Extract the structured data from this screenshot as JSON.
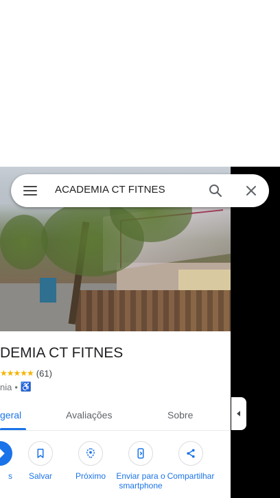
{
  "search": {
    "query": "ACADEMIA CT FITNES"
  },
  "place": {
    "title": "DEMIA CT FITNES",
    "stars": "★★★★★",
    "review_count": "(61)",
    "category": "nia",
    "separator": "•"
  },
  "tabs": [
    {
      "label": "geral",
      "active": true
    },
    {
      "label": "Avaliações",
      "active": false
    },
    {
      "label": "Sobre",
      "active": false
    }
  ],
  "actions": [
    {
      "label": "s",
      "icon": "directions-icon"
    },
    {
      "label": "Salvar",
      "icon": "bookmark-icon"
    },
    {
      "label": "Próximo",
      "icon": "nearby-icon"
    },
    {
      "label": "Enviar para o smartphone",
      "icon": "send-to-phone-icon"
    },
    {
      "label": "Compartilhar",
      "icon": "share-icon"
    }
  ],
  "colors": {
    "accent": "#1a73e8",
    "star": "#f4b400",
    "text": "#202124",
    "muted": "#70757a"
  }
}
